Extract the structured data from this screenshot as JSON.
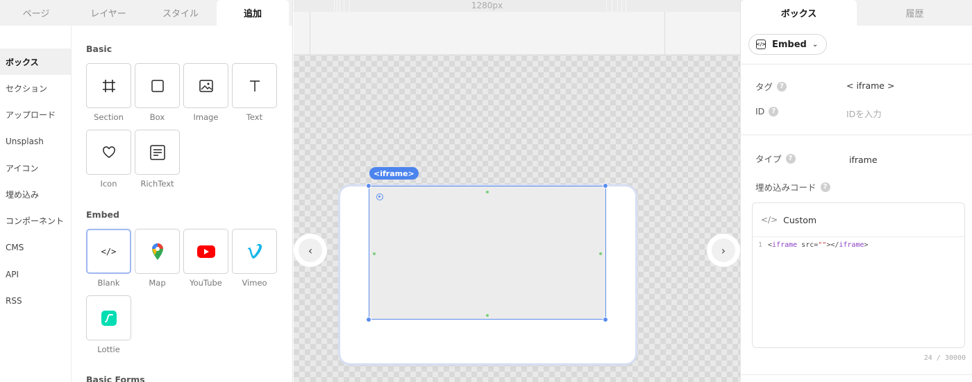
{
  "left_panel": {
    "tabs": [
      {
        "label": "ページ"
      },
      {
        "label": "レイヤー"
      },
      {
        "label": "スタイル"
      },
      {
        "label": "追加"
      }
    ],
    "active_tab": "追加",
    "categories": [
      {
        "label": "ボックス"
      },
      {
        "label": "セクション"
      },
      {
        "label": "アップロード"
      },
      {
        "label": "Unsplash"
      },
      {
        "label": "アイコン"
      },
      {
        "label": "埋め込み"
      },
      {
        "label": "コンポーネント"
      },
      {
        "label": "CMS"
      },
      {
        "label": "API"
      },
      {
        "label": "RSS"
      }
    ],
    "active_category": "ボックス",
    "sections": {
      "basic": {
        "title": "Basic",
        "items": [
          {
            "label": "Section",
            "icon": "section-icon"
          },
          {
            "label": "Box",
            "icon": "box-icon"
          },
          {
            "label": "Image",
            "icon": "image-icon"
          },
          {
            "label": "Text",
            "icon": "text-icon"
          },
          {
            "label": "Icon",
            "icon": "heart-icon"
          },
          {
            "label": "RichText",
            "icon": "richtext-icon"
          }
        ]
      },
      "embed": {
        "title": "Embed",
        "items": [
          {
            "label": "Blank",
            "icon": "code-icon"
          },
          {
            "label": "Map",
            "icon": "map-pin-icon"
          },
          {
            "label": "YouTube",
            "icon": "youtube-icon"
          },
          {
            "label": "Vimeo",
            "icon": "vimeo-icon"
          },
          {
            "label": "Lottie",
            "icon": "lottie-icon"
          }
        ]
      },
      "forms": {
        "title": "Basic Forms"
      }
    }
  },
  "canvas": {
    "width_label": "1280px",
    "element_tag": "<iframe>"
  },
  "right_panel": {
    "tabs": [
      {
        "label": "ボックス"
      },
      {
        "label": "履歴"
      }
    ],
    "active_tab": "ボックス",
    "element_type_button": "Embed",
    "props": {
      "tag": {
        "label": "タグ",
        "value": "< iframe >"
      },
      "id": {
        "label": "ID",
        "placeholder": "IDを入力"
      },
      "type": {
        "label": "タイプ",
        "value": "iframe"
      },
      "embed_code": {
        "label": "埋め込みコード"
      }
    },
    "code_editor": {
      "language_label": "Custom",
      "line_number": "1",
      "code": {
        "open_bracket": "<",
        "tag": "iframe",
        "attr": " src=",
        "value": "\"\"",
        "close_open": "></",
        "close_tag": "iframe",
        "close_bracket": ">"
      },
      "char_count": "24 / 30000"
    }
  },
  "colors": {
    "accent": "#4c84ee",
    "selection": "#5b8def",
    "youtube_red": "#ff0000",
    "vimeo_blue": "#1ab7ea",
    "lottie_teal": "#00ddb3"
  }
}
